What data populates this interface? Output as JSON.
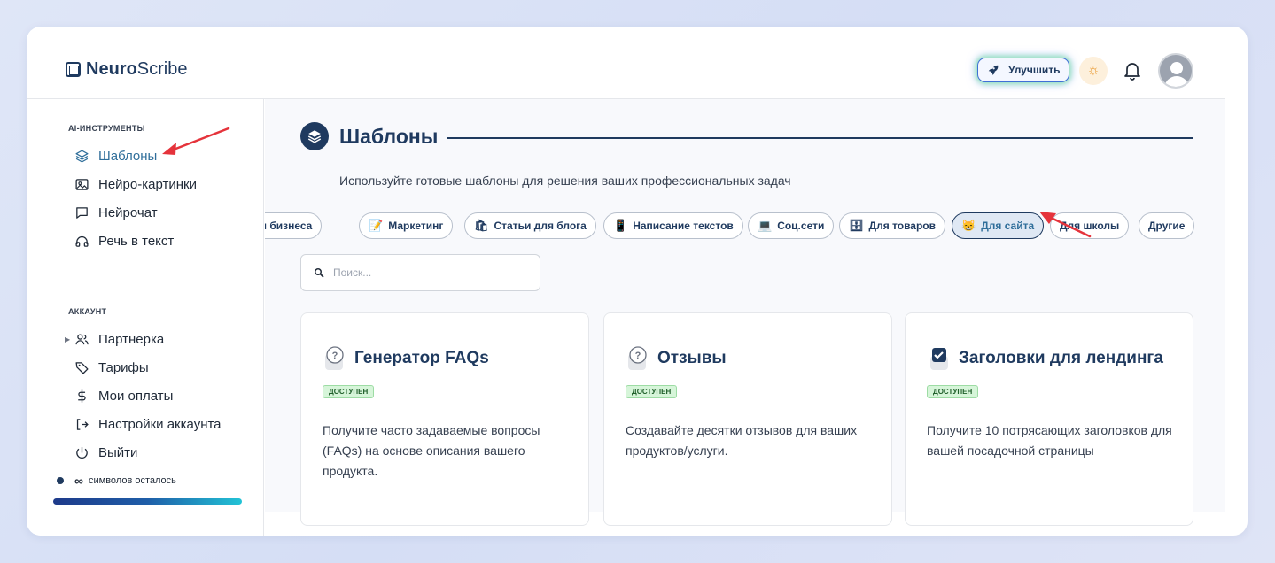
{
  "header": {
    "brand_strong": "Neuro",
    "brand_light": "Scribe",
    "upgrade_label": "Улучшить",
    "icons": {
      "logo": "logo-icon",
      "upgrade": "rocket-icon",
      "theme": "sun-icon",
      "notifications": "bell-icon",
      "user": "avatar-icon"
    }
  },
  "sidebar": {
    "tools_title": "AI-ИНСТРУМЕНТЫ",
    "tools": [
      {
        "label": "Шаблоны",
        "icon": "layers-icon",
        "active": true
      },
      {
        "label": "Нейро-картинки",
        "icon": "image-icon"
      },
      {
        "label": "Нейрочат",
        "icon": "chat-icon"
      },
      {
        "label": "Речь в текст",
        "icon": "headphones-icon"
      }
    ],
    "account_title": "АККАУНТ",
    "account": [
      {
        "label": "Партнерка",
        "icon": "users-icon"
      },
      {
        "label": "Тарифы",
        "icon": "tag-icon"
      },
      {
        "label": "Мои оплаты",
        "icon": "dollar-icon"
      },
      {
        "label": "Настройки аккаунта",
        "icon": "login-icon"
      },
      {
        "label": "Выйти",
        "icon": "power-icon"
      }
    ],
    "chars_symbol": "∞",
    "chars_label": "символов осталось"
  },
  "main": {
    "title": "Шаблоны",
    "subtitle": "Используйте готовые шаблоны для решения ваших профессиональных задач",
    "chips": [
      {
        "label": "я бизнеса",
        "emoji": ""
      },
      {
        "label": "Маркетинг",
        "emoji": "📝"
      },
      {
        "label": "Статьи для блога",
        "emoji": "🛍"
      },
      {
        "label": "Написание текстов",
        "emoji": "📱"
      },
      {
        "label": "Соц.сети",
        "emoji": "💻"
      },
      {
        "label": "Для товаров",
        "emoji": "🗄"
      },
      {
        "label": "Для сайта",
        "emoji": "😸",
        "active": true
      },
      {
        "label": "Для школы",
        "emoji": ""
      },
      {
        "label": "Другие",
        "emoji": ""
      }
    ],
    "search_placeholder": "Поиск...",
    "cards": [
      {
        "title": "Генератор FAQs",
        "emoji": "❓",
        "badge": "ДОСТУПЕН",
        "desc": "Получите часто задаваемые вопросы (FAQs) на основе описания вашего продукта."
      },
      {
        "title": "Отзывы",
        "emoji": "❓",
        "badge": "ДОСТУПЕН",
        "desc": "Создавайте десятки отзывов для ваших продуктов/услуги."
      },
      {
        "title": "Заголовки для лендинга",
        "emoji": "✅",
        "badge": "ДОСТУПЕН",
        "desc": "Получите 10 потрясающих заголовков для вашей посадочной страницы"
      }
    ]
  },
  "colors": {
    "accent": "#1f3a5f",
    "active": "#2f6e9a",
    "arrow": "#e5333b",
    "badge_bg": "#d6f5d9"
  }
}
